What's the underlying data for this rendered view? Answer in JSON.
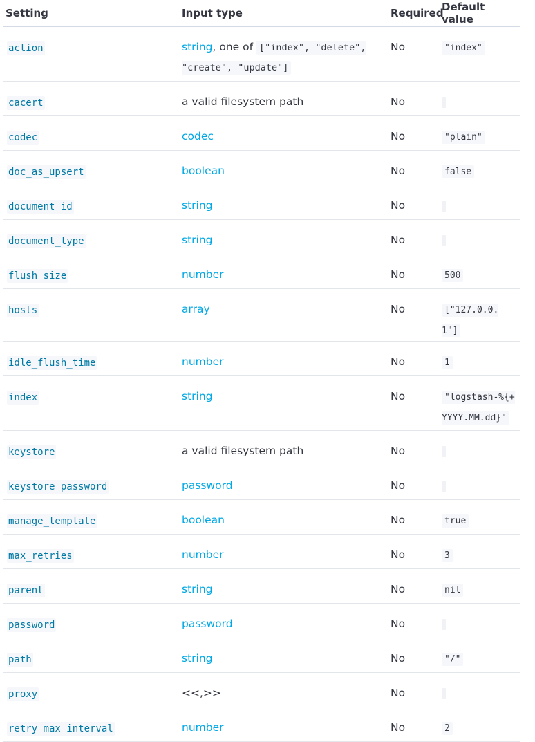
{
  "headers": {
    "setting": "Setting",
    "input_type": "Input type",
    "required": "Required",
    "default_value": "Default value"
  },
  "rows": [
    {
      "setting": "action",
      "type_link": "string",
      "type_suffix": ", one of",
      "type_code": "[\"index\", \"delete\", \"create\", \"update\"]",
      "required": "No",
      "default": "\"index\""
    },
    {
      "setting": "cacert",
      "type_plain": "a valid filesystem path",
      "required": "No",
      "default": ""
    },
    {
      "setting": "codec",
      "type_link": "codec",
      "required": "No",
      "default": "\"plain\""
    },
    {
      "setting": "doc_as_upsert",
      "type_link": "boolean",
      "required": "No",
      "default": "false"
    },
    {
      "setting": "document_id",
      "type_link": "string",
      "required": "No",
      "default": ""
    },
    {
      "setting": "document_type",
      "type_link": "string",
      "required": "No",
      "default": ""
    },
    {
      "setting": "flush_size",
      "type_link": "number",
      "required": "No",
      "default": "500"
    },
    {
      "setting": "hosts",
      "type_link": "array",
      "required": "No",
      "default": "[\"127.0.0.1\"]"
    },
    {
      "setting": "idle_flush_time",
      "type_link": "number",
      "required": "No",
      "default": "1"
    },
    {
      "setting": "index",
      "type_link": "string",
      "required": "No",
      "default": "\"logstash-%{+YYYY.MM.dd}\""
    },
    {
      "setting": "keystore",
      "type_plain": "a valid filesystem path",
      "required": "No",
      "default": ""
    },
    {
      "setting": "keystore_password",
      "type_link": "password",
      "required": "No",
      "default": ""
    },
    {
      "setting": "manage_template",
      "type_link": "boolean",
      "required": "No",
      "default": "true"
    },
    {
      "setting": "max_retries",
      "type_link": "number",
      "required": "No",
      "default": "3"
    },
    {
      "setting": "parent",
      "type_link": "string",
      "required": "No",
      "default": "nil"
    },
    {
      "setting": "password",
      "type_link": "password",
      "required": "No",
      "default": ""
    },
    {
      "setting": "path",
      "type_link": "string",
      "required": "No",
      "default": "\"/\""
    },
    {
      "setting": "proxy",
      "type_plain": "<<,>>",
      "required": "No",
      "default": ""
    },
    {
      "setting": "retry_max_interval",
      "type_link": "number",
      "required": "No",
      "default": "2"
    }
  ],
  "colors": {
    "link": "#00a9e5",
    "setting_code": "#0079a5",
    "text": "#343741",
    "border": "#e2e5ea"
  }
}
